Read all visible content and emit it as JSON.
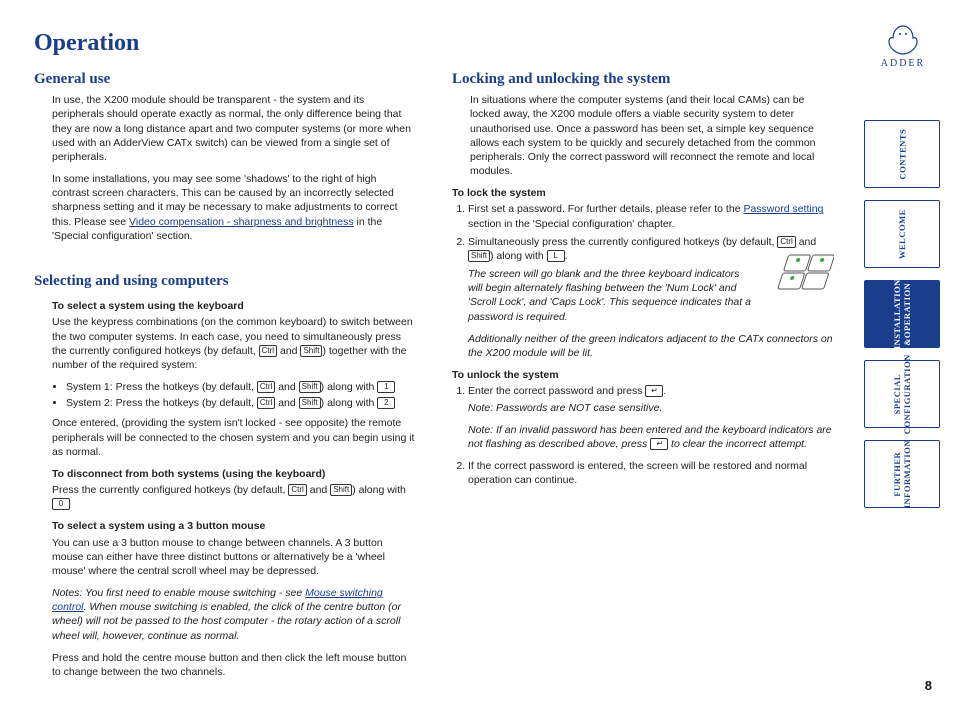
{
  "title": "Operation",
  "logo_text": "ADDER",
  "page_number": "8",
  "left": {
    "general_use": {
      "heading": "General use",
      "p1": "In use, the X200 module should be transparent - the system and its peripherals should operate exactly as normal, the only difference being that they are now a long distance apart and two computer systems (or more when used with an AdderView CATx switch) can be viewed from a single set of peripherals.",
      "p2a": "In some installations, you may see some 'shadows' to the right of high contrast screen characters. This can be caused by an incorrectly selected sharpness setting and it may be necessary to make adjustments to correct this. Please see ",
      "p2_link": "Video compensation - sharpness and brightness",
      "p2b": " in the 'Special configuration' section."
    },
    "selecting": {
      "heading": "Selecting and using computers",
      "sub1": "To select a system using the keyboard",
      "sub1_p1": "Use the keypress combinations (on the common keyboard) to switch between the two computer systems. In each case, you need to simultaneously press the currently configured hotkeys (by default, ",
      "sub1_p1b": ") together with the number of the required system:",
      "bullet1a": "System 1: Press the hotkeys (by default, ",
      "bullet1b": ") along with ",
      "bullet2a": "System 2: Press the hotkeys (by default, ",
      "bullet2b": ") along with ",
      "sub1_p2": "Once entered, (providing the system isn't locked - see opposite) the remote peripherals will be connected to the chosen system and you can begin using it as normal.",
      "sub2": "To disconnect from both systems (using the keyboard)",
      "sub2_p1a": "Press the currently configured hotkeys (by default, ",
      "sub2_p1b": ") along with ",
      "sub3": "To select a system using a 3 button mouse",
      "sub3_p1": "You can use a 3 button mouse to change between channels. A 3 button mouse can either have three distinct buttons or alternatively be a 'wheel mouse' where the central scroll wheel may be depressed.",
      "sub3_note_a": "Notes: You first need to enable mouse switching - see ",
      "sub3_link": "Mouse switching control",
      "sub3_note_b": ". When mouse switching is enabled, the click of the centre button (or wheel) will not be passed to the host computer - the rotary action of a scroll wheel will, however, continue as normal.",
      "sub3_p2": "Press and hold the centre mouse button and then click the left mouse button to change between the two channels."
    }
  },
  "right": {
    "locking": {
      "heading": "Locking and unlocking the system",
      "p1": "In situations where the computer systems (and their local CAMs) can be locked away, the X200 module offers a viable security system to deter unauthorised use. Once a password has been set, a simple key sequence allows each system to be quickly and securely detached from the common peripherals. Only the correct password will reconnect the remote and local modules.",
      "lock_head": "To lock the system",
      "l1a": "First set a password. For further details, please refer to the ",
      "l1_link": "Password setting",
      "l1b": " section in the 'Special configuration' chapter.",
      "l2a": "Simultaneously press the currently configured hotkeys (by default, ",
      "l2b": ") along with ",
      "l2_ital1": "The screen will go blank and the three keyboard indicators will begin alternately flashing between the 'Num Lock' and 'Scroll Lock', and 'Caps Lock'. This sequence indicates that a password is required.",
      "l2_ital2": "Additionally neither of the green indicators adjacent to the CATx connectors on the X200 module will be lit.",
      "unlock_head": "To unlock the system",
      "u1a": "Enter the correct password and press ",
      "u1b": ".",
      "u1_note1": "Note: Passwords are NOT case sensitive.",
      "u1_note2a": "Note: If an invalid password has been entered and the keyboard indicators are not flashing as described above, press ",
      "u1_note2b": " to clear the incorrect attempt.",
      "u2": "If the correct password is entered, the screen will be restored and normal operation can continue."
    }
  },
  "keys": {
    "ctrl": "Ctrl",
    "shift": "Shift",
    "and": " and ",
    "one": "1",
    "two": "2",
    "zero": "0",
    "L": "L",
    "enter": "↵"
  },
  "tabs": {
    "contents": "CONTENTS",
    "welcome": "WELCOME",
    "install": "INSTALLATION\n&OPERATION",
    "special": "SPECIAL\nCONFIGURATION",
    "further": "FURTHER\nINFORMATION"
  }
}
